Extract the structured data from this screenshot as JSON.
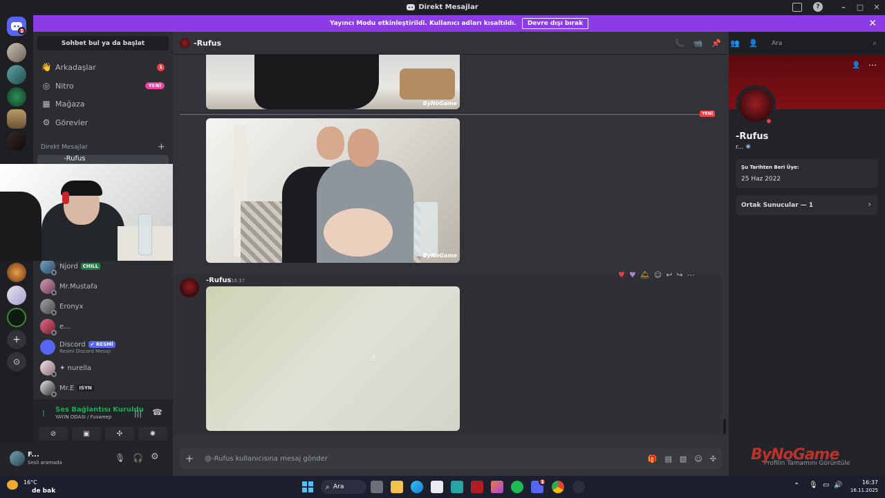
{
  "window": {
    "title": "Direkt Mesajlar",
    "controls": [
      "–",
      "□",
      "✕"
    ]
  },
  "banner": {
    "text": "Yayıncı Modu etkinleştirildi. Kullanıcı adları kısaltıldı.",
    "button": "Devre dışı bırak",
    "close": "✕"
  },
  "guilds": {
    "home_badge": "1",
    "add_server": "+",
    "explore": "⊙"
  },
  "sidebar": {
    "search": "Sohbet bul ya da başlat",
    "nav": [
      {
        "label": "Arkadaşlar",
        "icon": "friends-icon",
        "badge": "1"
      },
      {
        "label": "Nitro",
        "icon": "nitro-icon",
        "badge": "YENİ"
      },
      {
        "label": "Mağaza",
        "icon": "shop-icon"
      },
      {
        "label": "Görevler",
        "icon": "quests-icon"
      }
    ],
    "dm_header": "Direkt Mesajlar",
    "dm_plus": "+",
    "dm_partial": "-Rufus",
    "dms": [
      {
        "name": "Njord",
        "tag": "CHILL"
      },
      {
        "name": "Mr.Mustafa"
      },
      {
        "name": "Eronyx"
      },
      {
        "name": "e..."
      },
      {
        "name": "Discord",
        "tag": "✔ RESMİ",
        "sub": "Resmi Discord Mesajı"
      },
      {
        "name": "✦ nurella"
      },
      {
        "name": "Mr.E",
        "tag": "ISYN"
      }
    ]
  },
  "voice": {
    "title": "Ses Bağlantısı Kuruldu",
    "sub": "YAYIN ODASI / Fusweep"
  },
  "user": {
    "name": "F...",
    "status": "Sesli aramada"
  },
  "chat": {
    "header_title": "-Rufus",
    "search_placeholder": "Ara",
    "new_label": "YENİ",
    "message": {
      "author": "-Rufus",
      "time": "16:37"
    },
    "input_placeholder": "@-Rufus kullanıcısına mesaj gönder",
    "image_watermark": "ByNoGame"
  },
  "profile": {
    "name": "-Rufus",
    "sub": "r...",
    "member_since_label": "Şu Tarihten Beri Üye:",
    "member_since_value": "25 Haz 2022",
    "mutual": "Ortak Sunucular — 1",
    "footer": "Profilin Tamamını Görüntüle"
  },
  "watermark": "ByNoGame",
  "taskbar": {
    "weather_temp": "16°C",
    "weather_text": "de bak",
    "search": "Ara",
    "time": "16:37",
    "date": "16.11.2025",
    "discord_badge": "1"
  }
}
